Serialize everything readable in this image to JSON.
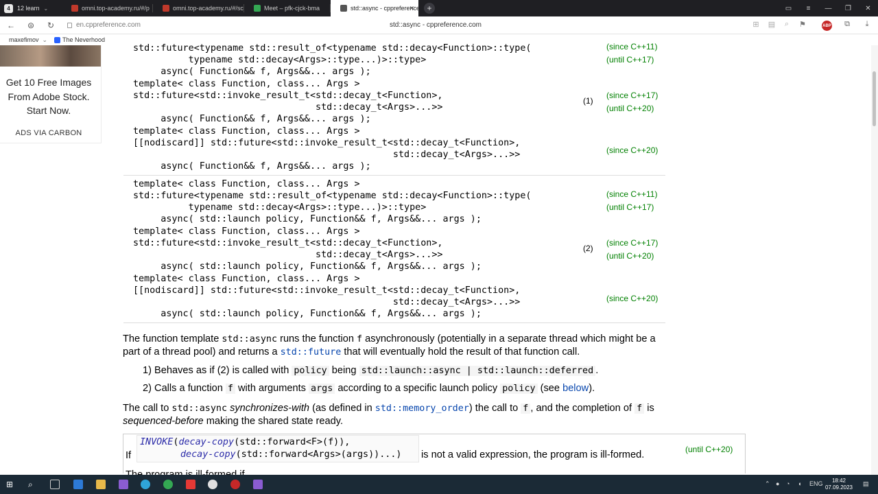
{
  "browser": {
    "workspace": {
      "count": "4",
      "label": "12 learn"
    },
    "tabs": [
      {
        "title": "omni.top-academy.ru/#/p",
        "fav_color": "#c0392b"
      },
      {
        "title": "omni.top-academy.ru/#/sc",
        "fav_color": "#c0392b"
      },
      {
        "title": "Meet – pfk-cjck-bma",
        "fav_color": "#34a853"
      },
      {
        "title": "std::async - cppreference",
        "fav_color": "#555555"
      }
    ],
    "new_tab": "+",
    "url": "en.cppreference.com",
    "page_title": "std::async - cppreference.com",
    "abp": "ABP",
    "bookmarks": [
      "maxefimov",
      "The Neverhood"
    ]
  },
  "ad": {
    "text": [
      "Get 10 Free Images",
      "From Adobe Stock.",
      "Start Now."
    ],
    "via": "ADS VIA CARBON"
  },
  "decl": {
    "lines": [
      "std::future<typename std::result_of<typename std::decay<Function>::type(",
      "          typename std::decay<Args>::type...)>::type>",
      "     async( Function&& f, Args&&... args );",
      "template< class Function, class... Args >",
      "std::future<std::invoke_result_t<std::decay_t<Function>,",
      "                                 std::decay_t<Args>...>>",
      "     async( Function&& f, Args&&... args );",
      "template< class Function, class... Args >",
      "[[nodiscard]] std::future<std::invoke_result_t<std::decay_t<Function>,",
      "                                               std::decay_t<Args>...>>",
      "     async( Function&& f, Args&&... args );",
      "template< class Function, class... Args >",
      "std::future<typename std::result_of<typename std::decay<Function>::type(",
      "          typename std::decay<Args>::type...)>::type>",
      "     async( std::launch policy, Function&& f, Args&&... args );",
      "template< class Function, class... Args >",
      "std::future<std::invoke_result_t<std::decay_t<Function>,",
      "                                 std::decay_t<Args>...>>",
      "     async( std::launch policy, Function&& f, Args&&... args );",
      "template< class Function, class... Args >",
      "[[nodiscard]] std::future<std::invoke_result_t<std::decay_t<Function>,",
      "                                               std::decay_t<Args>...>>",
      "     async( std::launch policy, Function&& f, Args&&... args );"
    ],
    "versions": [
      "(since C++11)",
      "(until C++17)",
      "(since C++17)",
      "(until C++20)",
      "(since C++20)",
      "(since C++11)",
      "(until C++17)",
      "(since C++17)",
      "(until C++20)",
      "(since C++20)"
    ],
    "numbers": [
      "(1)",
      "(2)"
    ]
  },
  "desc": {
    "p1_a": "The function template ",
    "p1_b": "std::async",
    "p1_c": " runs the function ",
    "p1_d": "f",
    "p1_e": " asynchronously (potentially in a separate thread which might be a",
    "p1_f": "part of a thread pool) and returns a ",
    "p1_g": "std::future",
    "p1_h": " that will eventually hold the result of that function call.",
    "li1_a": "1) Behaves as if (2) is called with ",
    "li1_b": "policy",
    "li1_c": " being ",
    "li1_d": "std::launch::async | std::launch::deferred",
    "li1_e": ".",
    "li2_a": "2) Calls a function ",
    "li2_b": "f",
    "li2_c": " with arguments ",
    "li2_d": "args",
    "li2_e": " according to a specific launch policy ",
    "li2_f": "policy",
    "li2_g": " (see ",
    "li2_h": "below",
    "li2_i": ").",
    "p2_a": "The call to ",
    "p2_b": "std::async",
    "p2_c": " synchronizes-with",
    "p2_d": " (as defined in ",
    "p2_e": "std::memory_order",
    "p2_f": ") the call to ",
    "p2_g": "f",
    "p2_h": ", and the completion of ",
    "p2_i": "f",
    "p2_j": " is",
    "p2_k": "sequenced-before",
    "p2_l": " making the shared state ready.",
    "box_if": "If",
    "box_expr1_a": "INVOKE",
    "box_expr1_b": "(",
    "box_expr1_c": "decay-copy",
    "box_expr1_d": "(std::forward<F>(f)),",
    "box_expr2_a": "decay-copy",
    "box_expr2_b": "(std::forward<Args>(args))...)",
    "box_tail": " is not a valid expression, the program is ill-formed.",
    "box_ver": "(until C++20)",
    "cut": "The program is ill-formed if"
  },
  "taskbar": {
    "lang": "ENG",
    "time": "18:42",
    "date": "07.09.2023"
  }
}
